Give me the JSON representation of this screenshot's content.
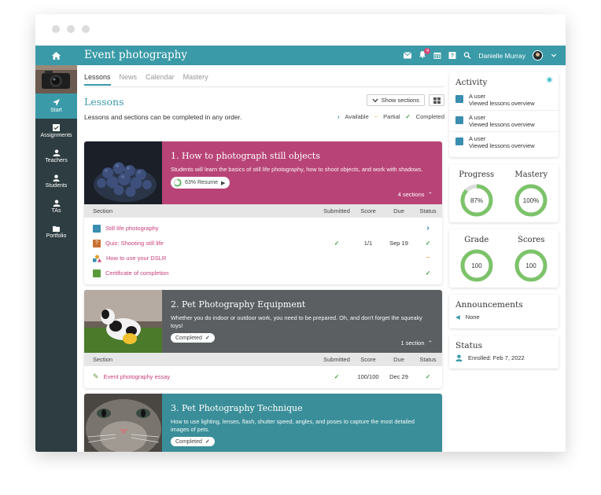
{
  "app": {
    "title": "Event photography",
    "user": "Danielle Murray",
    "notif_count": "4"
  },
  "sidebar": {
    "items": [
      {
        "label": "Start",
        "icon": "navigate-icon"
      },
      {
        "label": "Assignments",
        "icon": "checklist-icon"
      },
      {
        "label": "Teachers",
        "icon": "teachers-icon"
      },
      {
        "label": "Students",
        "icon": "student-icon"
      },
      {
        "label": "TAs",
        "icon": "tas-icon"
      },
      {
        "label": "Portfolio",
        "icon": "folder-icon"
      }
    ]
  },
  "tabs": [
    "Lessons",
    "News",
    "Calendar",
    "Mastery"
  ],
  "main": {
    "heading": "Lessons",
    "show_sections": "Show sections",
    "order_note": "Lessons and sections can be completed in any order.",
    "legend": {
      "available": "Available",
      "partial": "Partial",
      "completed": "Completed"
    }
  },
  "table_headers": {
    "section": "Section",
    "submitted": "Submitted",
    "score": "Score",
    "due": "Due",
    "status": "Status"
  },
  "lessons": [
    {
      "title": "1. How to photograph still objects",
      "desc": "Students will learn the basics of still life photography, how to shoot objects, and work with shadows.",
      "pill": "63% Resume",
      "progress": 0.63,
      "count": "4 sections",
      "color": "#b84477",
      "rows": [
        {
          "name": "Still life photography",
          "submitted": "",
          "score": "",
          "due": "",
          "status": "available",
          "icon": "page-icon"
        },
        {
          "name": "Quiz: Shooting still life",
          "submitted": "✓",
          "score": "1/1",
          "due": "Sep 19",
          "status": "completed",
          "icon": "quiz-icon"
        },
        {
          "name": "How to use your DSLR",
          "submitted": "",
          "score": "",
          "due": "",
          "status": "partial",
          "icon": "shapes-icon"
        },
        {
          "name": "Certificate of completion",
          "submitted": "",
          "score": "",
          "due": "",
          "status": "completed",
          "icon": "certificate-icon"
        }
      ]
    },
    {
      "title": "2. Pet Photography Equipment",
      "desc": "Whether you do indoor or outdoor work, you need to be prepared. Oh, and don't forget the squeaky toys!",
      "pill": "Completed",
      "count": "1 section",
      "color": "#5b5f62",
      "rows": [
        {
          "name": "Event photography essay",
          "submitted": "✓",
          "score": "100/100",
          "due": "Dec 29",
          "status": "completed",
          "icon": "pencil-icon"
        }
      ]
    },
    {
      "title": "3. Pet Photography Technique",
      "desc": "How to use lighting, lenses, flash, shutter speed, angles, and poses to capture the most detailed images of pets.",
      "pill": "Completed",
      "count": "",
      "color": "#3a8e99",
      "rows": []
    }
  ],
  "activity": {
    "title": "Activity",
    "items": [
      {
        "user": "A user",
        "text": "Viewed lessons overview"
      },
      {
        "user": "A user",
        "text": "Viewed lessons overview"
      },
      {
        "user": "A user",
        "text": "Viewed lessons overview"
      }
    ]
  },
  "metrics": {
    "progress": {
      "label": "Progress",
      "value": "87%",
      "frac": 0.87
    },
    "mastery": {
      "label": "Mastery",
      "value": "100%",
      "frac": 1.0
    },
    "grade": {
      "label": "Grade",
      "value": "100",
      "frac": 1.0
    },
    "scores": {
      "label": "Scores",
      "value": "100",
      "frac": 1.0
    }
  },
  "announcements": {
    "title": "Announcements",
    "text": "None"
  },
  "status": {
    "title": "Status",
    "text": "Enrolled: Feb 7, 2022"
  }
}
